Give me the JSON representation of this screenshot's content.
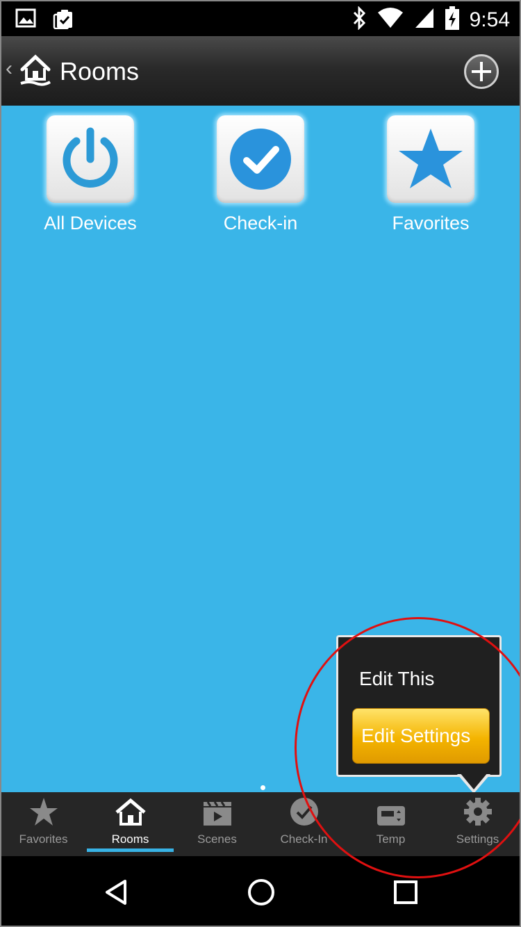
{
  "status_bar": {
    "time": "9:54",
    "icons": [
      "image-icon",
      "clipboard-check-icon",
      "bluetooth-icon",
      "wifi-icon",
      "signal-icon",
      "battery-charging-icon"
    ]
  },
  "header": {
    "title": "Rooms",
    "back_icon": "chevron-left-icon",
    "logo_icon": "home-hand-icon",
    "add_icon": "plus-circle-icon"
  },
  "tiles": [
    {
      "label": "All Devices",
      "icon": "power-icon"
    },
    {
      "label": "Check-in",
      "icon": "checkmark-circle-icon"
    },
    {
      "label": "Favorites",
      "icon": "star-icon"
    }
  ],
  "popup": {
    "item": "Edit This",
    "button": "Edit Settings"
  },
  "tabs": [
    {
      "label": "Favorites",
      "icon": "star-icon"
    },
    {
      "label": "Rooms",
      "icon": "home-icon",
      "active": true
    },
    {
      "label": "Scenes",
      "icon": "clapperboard-icon"
    },
    {
      "label": "Check-In",
      "icon": "checkmark-circle-icon"
    },
    {
      "label": "Temp",
      "icon": "thermostat-icon"
    },
    {
      "label": "Settings",
      "icon": "gear-icon"
    }
  ],
  "navigation": {
    "buttons": [
      "back-triangle-icon",
      "home-circle-icon",
      "recents-square-icon"
    ]
  },
  "colors": {
    "background": "#3ab5e8",
    "accent": "#38b3e6",
    "highlight_button": "#f4b400",
    "annotation": "#e01010"
  }
}
